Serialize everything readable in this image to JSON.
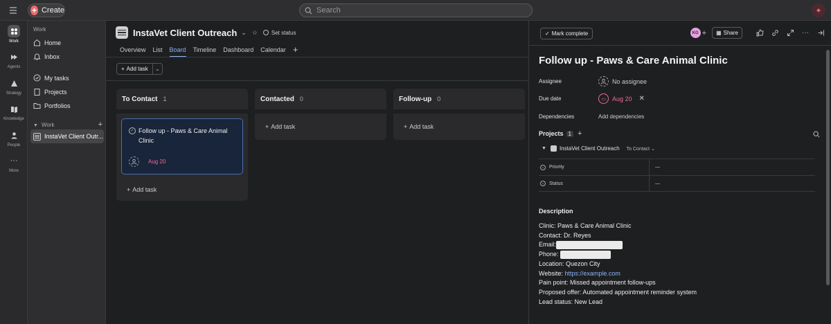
{
  "topbar": {
    "create_label": "Create",
    "search_placeholder": "Search"
  },
  "rail": {
    "items": [
      {
        "label": "Work",
        "icon": "grid-icon"
      },
      {
        "label": "Agents",
        "icon": "agents-icon"
      },
      {
        "label": "Strategy",
        "icon": "strategy-icon"
      },
      {
        "label": "Knowledge",
        "icon": "knowledge-icon"
      },
      {
        "label": "People",
        "icon": "people-icon"
      },
      {
        "label": "More",
        "icon": "more-icon"
      }
    ]
  },
  "sidebar": {
    "heading": "Work",
    "items": [
      {
        "label": "Home",
        "icon": "home-icon"
      },
      {
        "label": "Inbox",
        "icon": "bell-icon"
      },
      {
        "label": "My tasks",
        "icon": "check-circle-icon"
      },
      {
        "label": "Projects",
        "icon": "clipboard-icon"
      },
      {
        "label": "Portfolios",
        "icon": "folder-icon"
      }
    ],
    "section_label": "Work",
    "project_label": "InstaVet Client Outr..."
  },
  "project": {
    "title": "InstaVet Client Outreach",
    "set_status": "Set status",
    "tabs": [
      "Overview",
      "List",
      "Board",
      "Timeline",
      "Dashboard",
      "Calendar"
    ],
    "active_tab": "Board",
    "add_task": "Add task"
  },
  "board": {
    "columns": [
      {
        "name": "To Contact",
        "count": "1",
        "add_label": "Add task"
      },
      {
        "name": "Contacted",
        "count": "0",
        "add_label": "Add task"
      },
      {
        "name": "Follow-up",
        "count": "0",
        "add_label": "Add task"
      }
    ],
    "card": {
      "title": "Follow up - Paws & Care Animal Clinic",
      "due": "Aug 20"
    }
  },
  "detail": {
    "mark_complete": "Mark complete",
    "avatar_initials": "KG",
    "share": "Share",
    "title": "Follow up - Paws & Care Animal Clinic",
    "assignee_label": "Assignee",
    "assignee_value": "No assignee",
    "due_label": "Due date",
    "due_value": "Aug 20",
    "deps_label": "Dependencies",
    "deps_value": "Add dependencies",
    "projects_label": "Projects",
    "projects_count": "1",
    "project_name": "InstaVet Client Outreach",
    "project_section": "To Contact",
    "fields": [
      {
        "label": "Priority",
        "value": "—"
      },
      {
        "label": "Status",
        "value": "—"
      }
    ],
    "description_label": "Description",
    "description": {
      "clinic": "Clinic: Paws & Care Animal Clinic",
      "contact": "Contact: Dr. Reyes",
      "email_label": "Email:",
      "phone_label": "Phone:",
      "location": "Location: Quezon City",
      "website_label": "Website: ",
      "website_url": "https://example.com",
      "pain_point": "Pain point: Missed appointment follow-ups",
      "offer": "Proposed offer: Automated appointment reminder system",
      "lead_status": "Lead status: New Lead"
    }
  },
  "colors": {
    "accent": "#f06a6a",
    "due": "#f06a9a",
    "link": "#8ab4f8",
    "card_border": "#4d6fb0"
  }
}
